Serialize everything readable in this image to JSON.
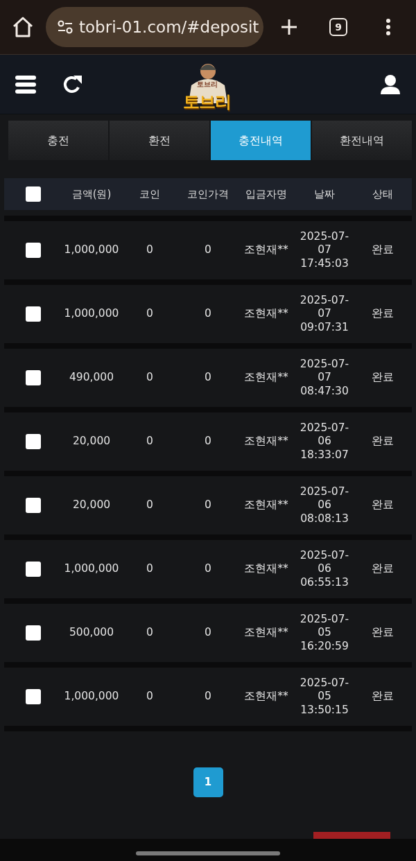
{
  "browser": {
    "url": "tobri-01.com/#deposit",
    "tab_count": "9"
  },
  "header": {
    "logo_text": "토브리",
    "logo_shirt_text": "토브리"
  },
  "tabs": [
    {
      "label": "충전",
      "selected": false
    },
    {
      "label": "환전",
      "selected": false
    },
    {
      "label": "충전내역",
      "selected": true
    },
    {
      "label": "환전내역",
      "selected": false
    }
  ],
  "table": {
    "select_all_checked": false,
    "columns": [
      "금액(원)",
      "코인",
      "코인가격",
      "입금자명",
      "날짜",
      "상태"
    ],
    "rows": [
      {
        "checked": false,
        "amount": "1,000,000",
        "coin": "0",
        "coin_price": "0",
        "depositor": "조현재**",
        "date": "2025-07-07 17:45:03",
        "status": "완료"
      },
      {
        "checked": false,
        "amount": "1,000,000",
        "coin": "0",
        "coin_price": "0",
        "depositor": "조현재**",
        "date": "2025-07-07 09:07:31",
        "status": "완료"
      },
      {
        "checked": false,
        "amount": "490,000",
        "coin": "0",
        "coin_price": "0",
        "depositor": "조현재**",
        "date": "2025-07-07 08:47:30",
        "status": "완료"
      },
      {
        "checked": false,
        "amount": "20,000",
        "coin": "0",
        "coin_price": "0",
        "depositor": "조현재**",
        "date": "2025-07-06 18:33:07",
        "status": "완료"
      },
      {
        "checked": false,
        "amount": "20,000",
        "coin": "0",
        "coin_price": "0",
        "depositor": "조현재**",
        "date": "2025-07-06 08:08:13",
        "status": "완료"
      },
      {
        "checked": false,
        "amount": "1,000,000",
        "coin": "0",
        "coin_price": "0",
        "depositor": "조현재**",
        "date": "2025-07-06 06:55:13",
        "status": "완료"
      },
      {
        "checked": false,
        "amount": "500,000",
        "coin": "0",
        "coin_price": "0",
        "depositor": "조현재**",
        "date": "2025-07-05 16:20:59",
        "status": "완료"
      },
      {
        "checked": false,
        "amount": "1,000,000",
        "coin": "0",
        "coin_price": "0",
        "depositor": "조현재**",
        "date": "2025-07-05 13:50:15",
        "status": "완료"
      }
    ]
  },
  "pagination": [
    {
      "label": "1",
      "selected": true
    }
  ]
}
